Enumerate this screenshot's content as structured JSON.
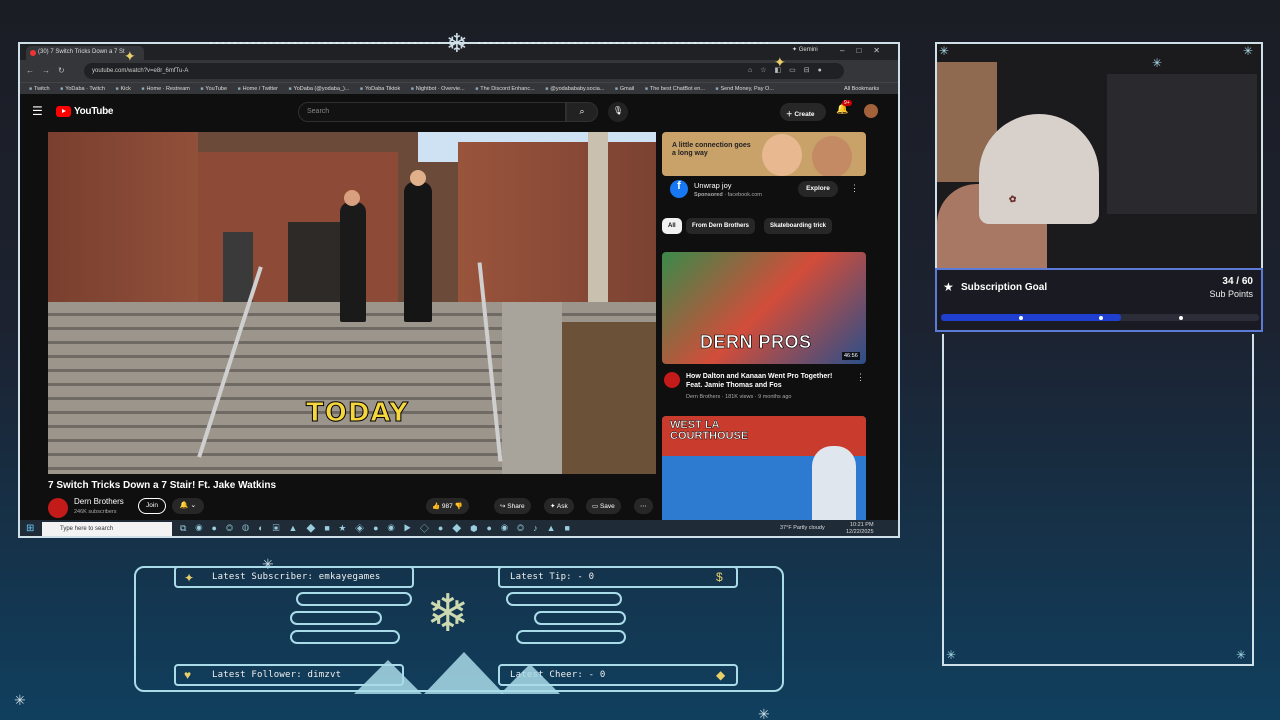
{
  "browser": {
    "tab_title": "(30) 7 Switch Tricks Down a 7 St",
    "gemini_label": "Gemini",
    "url": "youtube.com/watch?v=e8r_6mfTu-A",
    "bookmarks": [
      "Twitch",
      "YoDaba · Twitch",
      "Kick",
      "Home · Restream",
      "YouTube",
      "Home / Twitter",
      "YoDaba (@yodaba_)...",
      "YoDaba Tiktok",
      "Nightbot · Overvie...",
      "The Discord Enhanc...",
      "@yodabababy.socia...",
      "Gmail",
      "The best ChatBot en...",
      "Send Money, Pay O..."
    ],
    "all_bookmarks": "All Bookmarks"
  },
  "youtube": {
    "logo_text": "YouTube",
    "search_placeholder": "Search",
    "create_label": "Create",
    "notif_count": "9+",
    "caption": "TODAY",
    "video_title": "7 Switch Tricks Down a 7 Stair! Ft. Jake Watkins",
    "channel_name": "Dern Brothers",
    "channel_subs": "246K subscribers",
    "join_label": "Join",
    "likes": "987",
    "share_label": "Share",
    "ask_label": "Ask",
    "save_label": "Save",
    "ad": {
      "headline": "A little connection goes a long way",
      "title": "Unwrap joy",
      "sponsored": "Sponsored",
      "domain": "facebook.com",
      "explore_label": "Explore"
    },
    "chips": [
      "All",
      "From Dern Brothers",
      "Skateboarding trick"
    ],
    "recommended": [
      {
        "thumb_text": "DERN PROS",
        "duration": "46:56",
        "title": "How Dalton and Kanaan Went Pro Together! Feat. Jamie Thomas and Fos",
        "meta": "Dern Brothers · 181K views · 9 months ago"
      },
      {
        "thumb_text": "WEST LA COURTHOUSE"
      }
    ]
  },
  "taskbar": {
    "search_placeholder": "Type here to search",
    "weather": "37°F  Partly cloudy",
    "time": "10:21 PM",
    "date": "12/22/2025"
  },
  "overlay": {
    "subscription": {
      "title": "Subscription Goal",
      "count": "34 / 60",
      "unit": "Sub Points",
      "progress": 0.567
    },
    "alerts": {
      "latest_subscriber": "Latest Subscriber: emkayegames",
      "latest_tip": "Latest Tip:  - 0",
      "latest_follower": "Latest Follower: dimzvt",
      "latest_cheer": "Latest Cheer:  - 0"
    },
    "accent_color": "#a9dbe8",
    "gold_color": "#e9cf6a",
    "progress_color": "#1f3fd0"
  }
}
